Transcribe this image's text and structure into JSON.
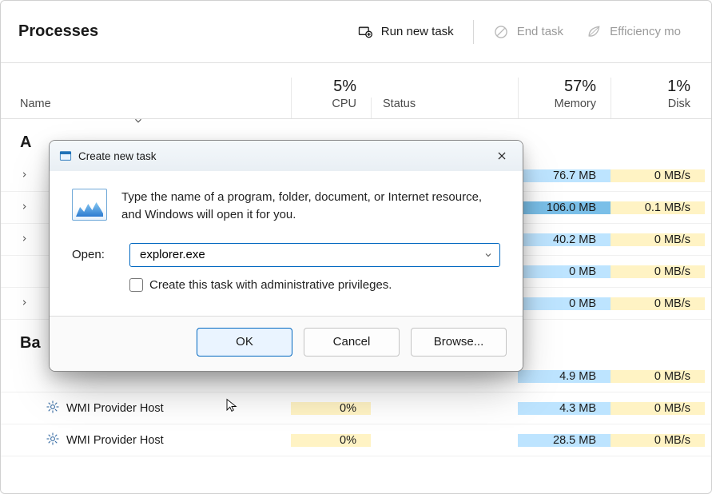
{
  "page": {
    "title": "Processes"
  },
  "toolbar": {
    "run_new_task": "Run new task",
    "end_task": "End task",
    "efficiency": "Efficiency mo"
  },
  "columns": {
    "name": "Name",
    "cpu": "CPU",
    "cpu_pct": "5%",
    "status": "Status",
    "memory": "Memory",
    "memory_pct": "57%",
    "disk": "Disk",
    "disk_pct": "1%"
  },
  "groups": {
    "apps": "A",
    "background": "Ba"
  },
  "rows": [
    {
      "kind": "app",
      "expand": true,
      "cpu": "",
      "mem": "76.7 MB",
      "mem_high": false,
      "disk": "0 MB/s"
    },
    {
      "kind": "app",
      "expand": true,
      "cpu": "",
      "mem": "106.0 MB",
      "mem_high": true,
      "disk": "0.1 MB/s"
    },
    {
      "kind": "app",
      "expand": true,
      "cpu": "",
      "mem": "40.2 MB",
      "mem_high": false,
      "disk": "0 MB/s"
    },
    {
      "kind": "app",
      "expand": false,
      "cpu": "",
      "mem": "0 MB",
      "mem_high": false,
      "disk": "0 MB/s"
    },
    {
      "kind": "app",
      "expand": true,
      "cpu": "",
      "mem": "0 MB",
      "mem_high": false,
      "disk": "0 MB/s"
    },
    {
      "kind": "bg",
      "expand": false,
      "cpu": "",
      "mem": "4.9 MB",
      "mem_high": false,
      "disk": "0 MB/s"
    },
    {
      "kind": "bg-child",
      "name": "WMI Provider Host",
      "cpu": "0%",
      "mem": "4.3 MB",
      "mem_high": false,
      "disk": "0 MB/s"
    },
    {
      "kind": "bg-child",
      "name": "WMI Provider Host",
      "cpu": "0%",
      "mem": "28.5 MB",
      "mem_high": false,
      "disk": "0 MB/s"
    }
  ],
  "dialog": {
    "title": "Create new task",
    "description": "Type the name of a program, folder, document, or Internet resource, and Windows will open it for you.",
    "open_label": "Open:",
    "open_value": "explorer.exe",
    "admin_check": "Create this task with administrative privileges.",
    "ok": "OK",
    "cancel": "Cancel",
    "browse": "Browse..."
  }
}
